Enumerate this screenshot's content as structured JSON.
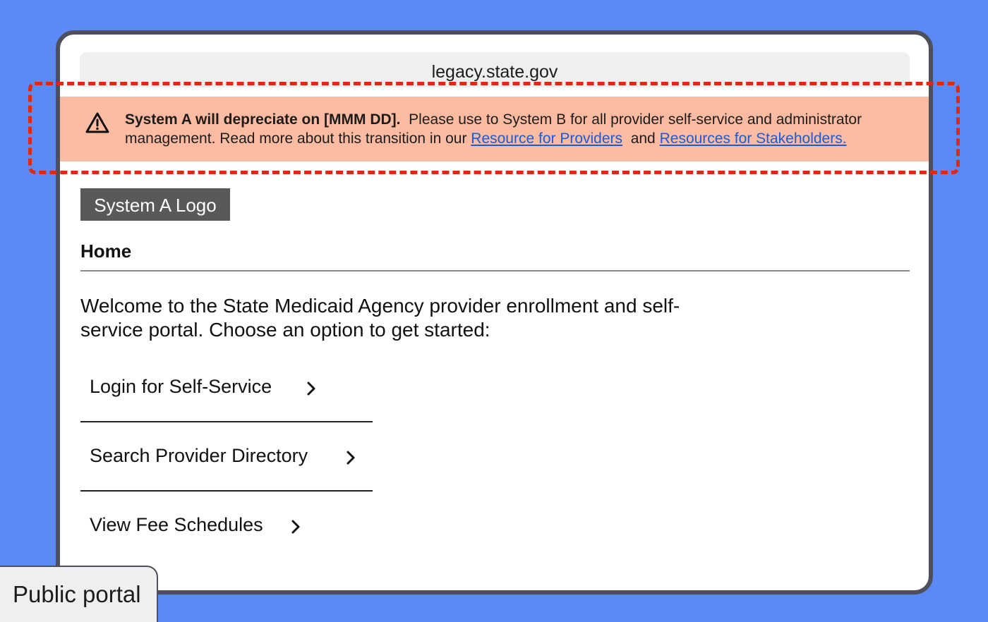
{
  "browser": {
    "url": "legacy.state.gov"
  },
  "banner": {
    "icon": "warning-triangle-icon",
    "bold_text": "System A will depreciate on [MMM DD].",
    "message": "Please use to System B for all provider self-service and administrator management. Read more about this transition in our",
    "link1": "Resource for Providers",
    "conjunction": "and",
    "link2": "Resources for Stakeholders.",
    "background": "#fdbba2",
    "highlight_color": "#e0280f"
  },
  "header": {
    "logo": "System A Logo",
    "nav_home": "Home"
  },
  "main": {
    "welcome": "Welcome to the State Medicaid Agency provider enrollment and self-service portal. Choose an option to get started:",
    "options": [
      {
        "label": "Login for Self-Service",
        "icon": "chevron-right-icon"
      },
      {
        "label": "Search Provider Directory",
        "icon": "chevron-right-icon"
      },
      {
        "label": "View Fee Schedules",
        "icon": "chevron-right-icon"
      }
    ]
  },
  "tag": {
    "label": "Public portal"
  },
  "colors": {
    "background": "#5b8af7",
    "frame": "#4d4f5c",
    "link": "#1a5bd6"
  }
}
